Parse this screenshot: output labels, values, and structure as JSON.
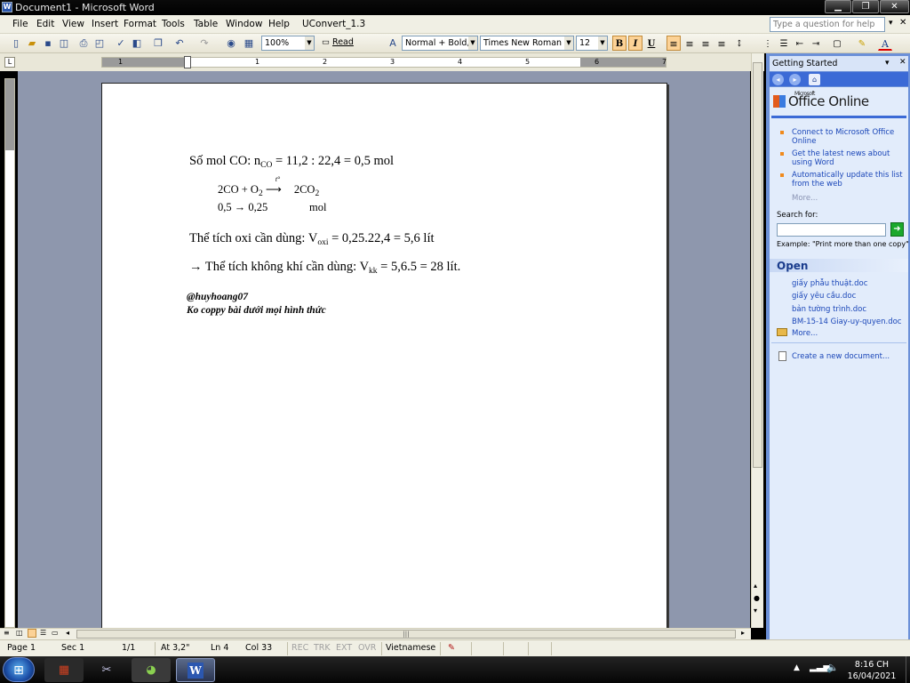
{
  "window": {
    "title": "Document1 - Microsoft Word",
    "minimize": "▁",
    "restore": "❐",
    "close": "✕"
  },
  "menu": {
    "items": [
      "File",
      "Edit",
      "View",
      "Insert",
      "Format",
      "Tools",
      "Table",
      "Window",
      "Help",
      "UConvert_1.3"
    ],
    "help_placeholder": "Type a question for help",
    "close_doc": "✕"
  },
  "toolbar": {
    "zoom": "100%",
    "read": "Read",
    "style": "Normal + Bold, It",
    "font": "Times New Roman",
    "size": "12",
    "bold": "B",
    "italic": "I",
    "underline": "U",
    "bold_on": true,
    "italic_on": true
  },
  "ruler": {
    "numbers": [
      "1",
      "1",
      "2",
      "3",
      "4",
      "5",
      "6",
      "7"
    ]
  },
  "document": {
    "line1_pre": "Số mol CO: n",
    "line1_sub": "CO",
    "line1_post": " = 11,2 : 22,4 = 0,5 mol",
    "eq_left": "2CO + O",
    "eq_o2_sub": "2",
    "eq_arrow": "t°",
    "eq_right": "2CO",
    "eq_right_sub": "2",
    "ratio": "0,5 → 0,25",
    "ratio_unit": "mol",
    "line3_pre": "Thể tích oxi cần dùng: V",
    "line3_sub": "oxi",
    "line3_post": " = 0,25.22,4 = 5,6 lít",
    "line4_pre": "→ Thể tích không khí cần dùng: V",
    "line4_sub": "kk",
    "line4_post": " = 5,6.5 = 28 lít.",
    "sig1": "@huyhoang07",
    "sig2": "Ko coppy bài dưới mọi hình thức"
  },
  "task_pane": {
    "title": "Getting Started",
    "brand_small": "Microsoft",
    "brand": "Office Online",
    "links": [
      "Connect to Microsoft Office Online",
      "Get the latest news about using Word",
      "Automatically update this list from the web"
    ],
    "more": "More...",
    "search_label": "Search for:",
    "example": "Example:  \"Print more than one copy\"",
    "open_header": "Open",
    "files": [
      "giấy phẫu thuật.doc",
      "giấy yêu cầu.doc",
      "bản tường trình.doc",
      "BM-15-14 Giay-uy-quyen.doc"
    ],
    "open_more": "More...",
    "create": "Create a new document..."
  },
  "status": {
    "page": "Page 1",
    "sec": "Sec 1",
    "pages": "1/1",
    "at": "At 3,2\"",
    "ln": "Ln 4",
    "col": "Col 33",
    "rec": "REC",
    "trk": "TRK",
    "ext": "EXT",
    "ovr": "OVR",
    "lang": "Vietnamese"
  },
  "taskbar": {
    "time": "8:16 CH",
    "date": "16/04/2021"
  }
}
